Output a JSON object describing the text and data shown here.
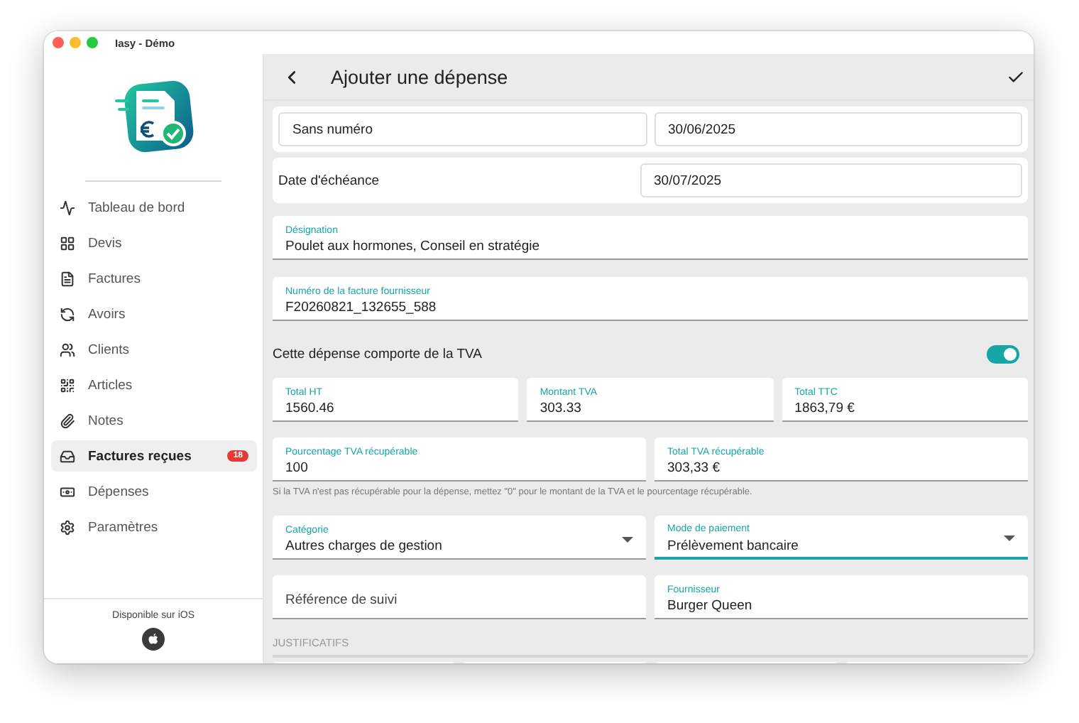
{
  "window": {
    "title": "Iasy - Démo"
  },
  "sidebar": {
    "items": [
      {
        "label": "Tableau de bord",
        "selected": false
      },
      {
        "label": "Devis",
        "selected": false
      },
      {
        "label": "Factures",
        "selected": false
      },
      {
        "label": "Avoirs",
        "selected": false
      },
      {
        "label": "Clients",
        "selected": false
      },
      {
        "label": "Articles",
        "selected": false
      },
      {
        "label": "Notes",
        "selected": false
      },
      {
        "label": "Factures reçues",
        "selected": true,
        "badge": "18"
      },
      {
        "label": "Dépenses",
        "selected": false
      },
      {
        "label": "Paramètres",
        "selected": false
      }
    ],
    "footer": "Disponible sur iOS"
  },
  "header": {
    "title": "Ajouter une dépense"
  },
  "form": [
    {
      "kind": "boxed",
      "fields": [
        {
          "value": "Sans numéro"
        },
        {
          "value": "30/06/2025"
        }
      ]
    },
    {
      "kind": "labeled",
      "label": "Date d'échéance",
      "fields": [
        {
          "value": "30/07/2025"
        }
      ]
    },
    {
      "kind": "fields",
      "fields": [
        {
          "label": "Désignation",
          "value": "Poulet aux hormones, Conseil en stratégie",
          "focused": false
        }
      ]
    },
    {
      "kind": "fields",
      "fields": [
        {
          "label": "Numéro de la facture fournisseur",
          "value": "F20260821_132655_588",
          "focused": false
        }
      ]
    },
    {
      "kind": "toggle",
      "label": "Cette dépense comporte de la TVA",
      "on": true
    },
    {
      "kind": "fields",
      "fields": [
        {
          "label": "Total HT",
          "value": "1560.46",
          "focused": false
        },
        {
          "label": "Montant TVA",
          "value": "303.33",
          "focused": false
        },
        {
          "label": "Total TTC",
          "value": "1863,79 €",
          "focused": false
        }
      ]
    },
    {
      "kind": "fields",
      "fields": [
        {
          "label": "Pourcentage TVA récupérable",
          "value": "100",
          "focused": false
        },
        {
          "label": "Total TVA récupérable",
          "value": "303,33 €",
          "focused": false
        }
      ]
    },
    {
      "kind": "hint",
      "text": "Si la TVA n'est pas récupérable pour la dépense, mettez \"0\" pour le montant de la TVA et le pourcentage récupérable."
    },
    {
      "kind": "fields",
      "fields": [
        {
          "label": "Catégorie",
          "value": "Autres charges de gestion",
          "dropdown": true,
          "focused": false
        },
        {
          "label": "Mode de paiement",
          "value": "Prélèvement bancaire",
          "dropdown": true,
          "focused": true
        }
      ]
    },
    {
      "kind": "fields",
      "fields": [
        {
          "placeholder": "Référence de suivi",
          "focused": false
        },
        {
          "label": "Fournisseur",
          "value": "Burger Queen",
          "focused": false
        }
      ]
    },
    {
      "kind": "section",
      "title": "JUSTIFICATIFS"
    }
  ]
}
